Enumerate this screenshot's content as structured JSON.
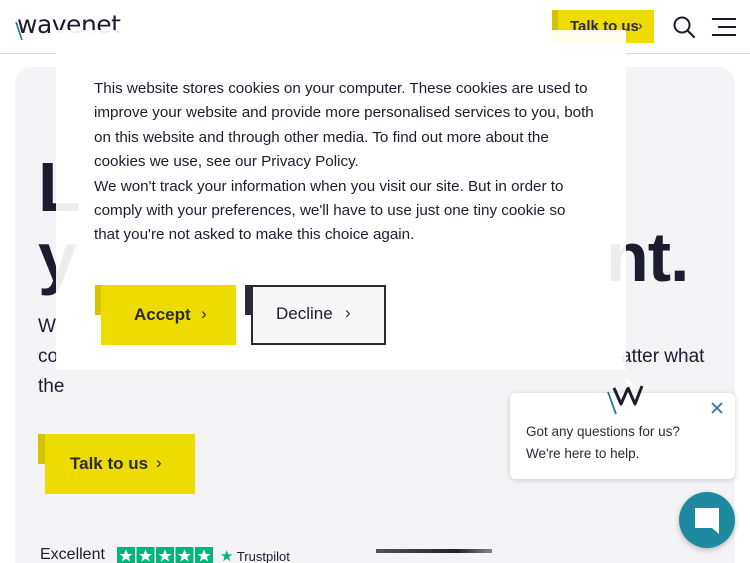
{
  "header": {
    "logo_text": "wavenet",
    "talk_label": "Talk to us",
    "talk_chevron": "›",
    "search_icon": "search-icon",
    "menu_icon": "hamburger-menu-icon"
  },
  "hero": {
    "title_line1": "L",
    "title_line2": "y",
    "title_line2_end": "nt.",
    "subtitle_start": "W",
    "subtitle_line2": "co",
    "subtitle_line2_end": "atter what",
    "subtitle_line3": "the",
    "cta_label": "Talk to us",
    "cta_chevron": "›",
    "trust_label": "Excellent",
    "trust_rating_stars": 5,
    "trust_brand": "Trustpilot"
  },
  "cookie_banner": {
    "text_1": "This website stores cookies on your computer. These cookies are used to improve your website and provide more personalised services to you, both on this website and through other media. To find out more about the cookies we use, see our Privacy Policy.",
    "text_2": "We won't track your information when you visit our site. But in order to comply with your preferences, we'll have to use just one tiny cookie so that you're not asked to make this choice again.",
    "accept_label": "Accept",
    "decline_label": "Decline",
    "chevron": "›"
  },
  "chat": {
    "message": "Got any questions for us? We're here to help.",
    "close_icon": "close-icon",
    "launcher_icon": "chat-icon"
  },
  "colors": {
    "accent_yellow": "#eedc00",
    "dark_navy": "#1c1c2e",
    "chat_teal": "#1d8aa0",
    "trustpilot_green": "#00b67a"
  }
}
